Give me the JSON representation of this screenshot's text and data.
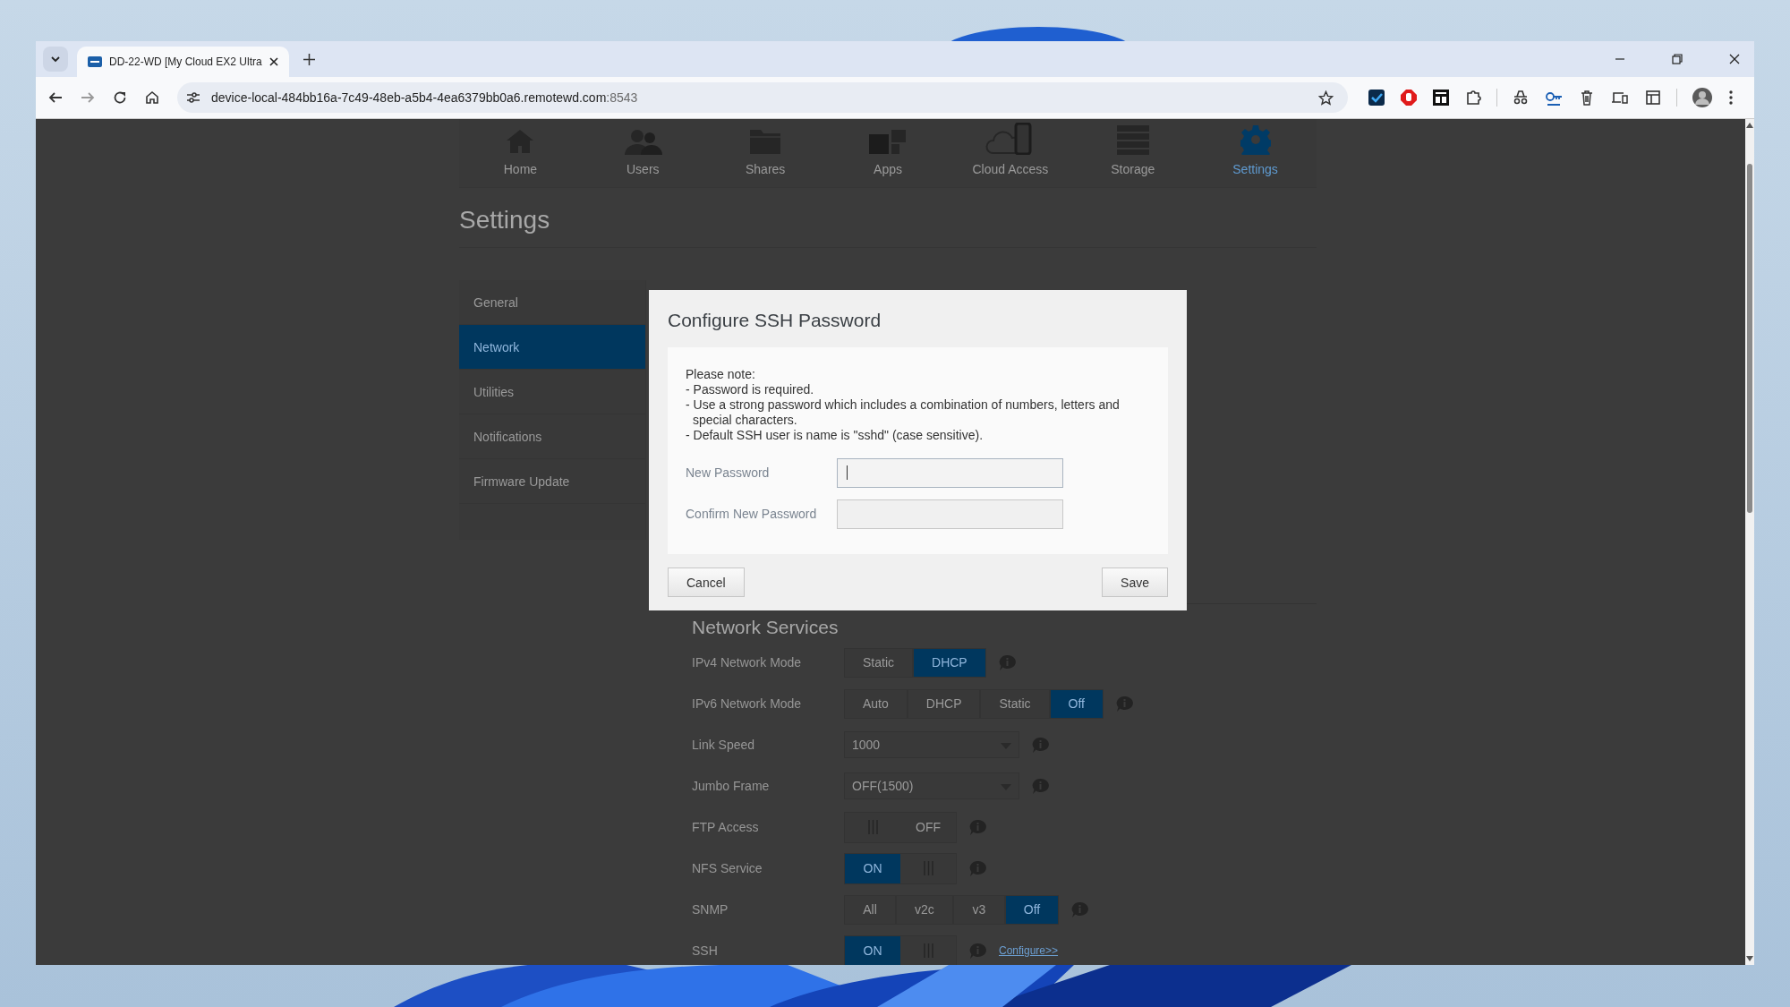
{
  "browser": {
    "tabs": [
      {
        "title": "DD-22-WD [My Cloud EX2 Ultra",
        "selected": true
      }
    ],
    "url_host": "device-local-484bb16a-7c49-48eb-a5b4-4ea6379bb0a6.remotewd.com",
    "url_port": ":8543"
  },
  "nav": [
    {
      "label": "Home",
      "selected": false
    },
    {
      "label": "Users",
      "selected": false
    },
    {
      "label": "Shares",
      "selected": false
    },
    {
      "label": "Apps",
      "selected": false
    },
    {
      "label": "Cloud Access",
      "selected": false
    },
    {
      "label": "Storage",
      "selected": false
    },
    {
      "label": "Settings",
      "selected": true
    }
  ],
  "page_title": "Settings",
  "sidebar": [
    {
      "label": "General",
      "selected": false
    },
    {
      "label": "Network",
      "selected": true
    },
    {
      "label": "Utilities",
      "selected": false
    },
    {
      "label": "Notifications",
      "selected": false
    },
    {
      "label": "Firmware Update",
      "selected": false
    }
  ],
  "section_title": "Network Services",
  "settings": [
    {
      "label": "IPv4 Network Mode",
      "kind": "segmented",
      "options": [
        {
          "label": "Static",
          "selected": false
        },
        {
          "label": "DHCP",
          "selected": true
        }
      ]
    },
    {
      "label": "IPv6 Network Mode",
      "kind": "segmented",
      "options": [
        {
          "label": "Auto",
          "selected": false
        },
        {
          "label": "DHCP",
          "selected": false
        },
        {
          "label": "Static",
          "selected": false
        },
        {
          "label": "Off",
          "selected": true
        }
      ]
    },
    {
      "label": "Link Speed",
      "kind": "dropdown",
      "value": "1000"
    },
    {
      "label": "Jumbo Frame",
      "kind": "dropdown",
      "value": "OFF(1500)"
    },
    {
      "label": "FTP Access",
      "kind": "toggle",
      "on": false,
      "state_label": "OFF"
    },
    {
      "label": "NFS Service",
      "kind": "toggle",
      "on": true,
      "state_label": "ON"
    },
    {
      "label": "SNMP",
      "kind": "segmented",
      "options": [
        {
          "label": "All",
          "selected": false
        },
        {
          "label": "v2c",
          "selected": false
        },
        {
          "label": "v3",
          "selected": false
        },
        {
          "label": "Off",
          "selected": true
        }
      ]
    },
    {
      "label": "SSH",
      "kind": "toggle",
      "on": true,
      "state_label": "ON",
      "link": "Configure>>"
    }
  ],
  "dialog": {
    "title": "Configure SSH Password",
    "note_lines": [
      "Please note:",
      "- Password is required.",
      "- Use a strong password which includes a combination of numbers, letters and special characters.",
      "- Default SSH user is name is \"sshd\" (case sensitive)."
    ],
    "fields": [
      {
        "label": "New Password",
        "focused": true
      },
      {
        "label": "Confirm New Password",
        "focused": false
      }
    ],
    "cancel": "Cancel",
    "save": "Save"
  }
}
